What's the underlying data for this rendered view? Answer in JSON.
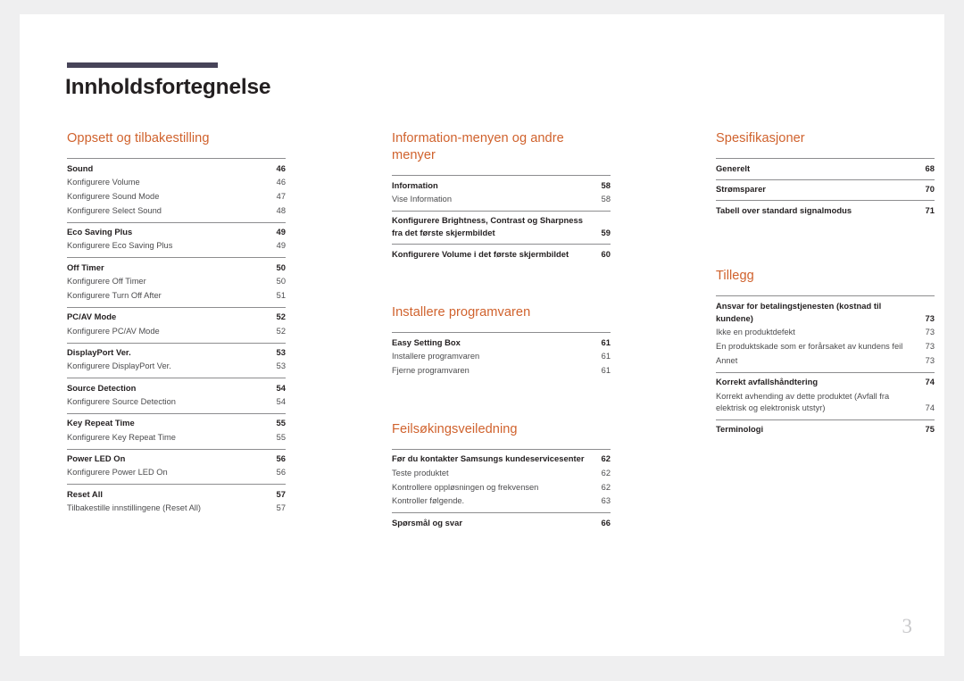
{
  "document": {
    "title": "Innholdsfortegnelse",
    "folio": "3",
    "accent_color": "#d0622d",
    "rule_color": "#474459",
    "text_color": "#231f20"
  },
  "columns": [
    {
      "id": "column-1",
      "sections": [
        {
          "heading": "Oppsett og tilbakestilling",
          "groups": [
            {
              "entries": [
                {
                  "level": 1,
                  "label": "Sound",
                  "page": "46"
                },
                {
                  "level": 2,
                  "label": "Konfigurere Volume",
                  "page": "46"
                },
                {
                  "level": 2,
                  "label": "Konfigurere Sound Mode",
                  "page": "47"
                },
                {
                  "level": 2,
                  "label": "Konfigurere Select Sound",
                  "page": "48"
                }
              ]
            },
            {
              "entries": [
                {
                  "level": 1,
                  "label": "Eco Saving Plus",
                  "page": "49"
                },
                {
                  "level": 2,
                  "label": "Konfigurere Eco Saving Plus",
                  "page": "49"
                }
              ]
            },
            {
              "entries": [
                {
                  "level": 1,
                  "label": "Off Timer",
                  "page": "50"
                },
                {
                  "level": 2,
                  "label": "Konfigurere Off Timer",
                  "page": "50"
                },
                {
                  "level": 2,
                  "label": "Konfigurere Turn Off After",
                  "page": "51"
                }
              ]
            },
            {
              "entries": [
                {
                  "level": 1,
                  "label": "PC/AV Mode",
                  "page": "52"
                },
                {
                  "level": 2,
                  "label": "Konfigurere PC/AV Mode",
                  "page": "52"
                }
              ]
            },
            {
              "entries": [
                {
                  "level": 1,
                  "label": "DisplayPort Ver.",
                  "page": "53"
                },
                {
                  "level": 2,
                  "label": "Konfigurere DisplayPort Ver.",
                  "page": "53"
                }
              ]
            },
            {
              "entries": [
                {
                  "level": 1,
                  "label": "Source Detection",
                  "page": "54"
                },
                {
                  "level": 2,
                  "label": "Konfigurere Source Detection",
                  "page": "54"
                }
              ]
            },
            {
              "entries": [
                {
                  "level": 1,
                  "label": "Key Repeat Time",
                  "page": "55"
                },
                {
                  "level": 2,
                  "label": "Konfigurere Key Repeat Time",
                  "page": "55"
                }
              ]
            },
            {
              "entries": [
                {
                  "level": 1,
                  "label": "Power LED On",
                  "page": "56"
                },
                {
                  "level": 2,
                  "label": "Konfigurere Power LED On",
                  "page": "56"
                }
              ]
            },
            {
              "entries": [
                {
                  "level": 1,
                  "label": "Reset All",
                  "page": "57"
                },
                {
                  "level": 2,
                  "label": "Tilbakestille innstillingene (Reset All)",
                  "page": "57"
                }
              ]
            }
          ]
        }
      ]
    },
    {
      "id": "column-2",
      "sections": [
        {
          "heading": "Information-menyen og andre menyer",
          "groups": [
            {
              "entries": [
                {
                  "level": 1,
                  "label": "Information",
                  "page": "58"
                },
                {
                  "level": 2,
                  "label": "Vise Information",
                  "page": "58"
                }
              ]
            },
            {
              "entries": [
                {
                  "level": 1,
                  "multiline": true,
                  "label": "Konfigurere Brightness, Contrast og Sharpness fra det første skjermbildet",
                  "page": "59"
                }
              ]
            },
            {
              "entries": [
                {
                  "level": 1,
                  "multiline": true,
                  "label": "Konfigurere Volume i det første skjermbildet",
                  "page": "60"
                }
              ]
            }
          ]
        },
        {
          "heading": "Installere programvaren",
          "groups": [
            {
              "entries": [
                {
                  "level": 1,
                  "label": "Easy Setting Box",
                  "page": "61"
                },
                {
                  "level": 2,
                  "label": "Installere programvaren",
                  "page": "61"
                },
                {
                  "level": 2,
                  "label": "Fjerne programvaren",
                  "page": "61"
                }
              ]
            }
          ]
        },
        {
          "heading": "Feilsøkingsveiledning",
          "groups": [
            {
              "entries": [
                {
                  "level": 1,
                  "multiline": true,
                  "label": "Før du kontakter Samsungs kundeservicesenter",
                  "page": "62"
                },
                {
                  "level": 2,
                  "label": "Teste produktet",
                  "page": "62"
                },
                {
                  "level": 2,
                  "label": "Kontrollere oppløsningen og frekvensen",
                  "page": "62"
                },
                {
                  "level": 2,
                  "label": "Kontroller følgende.",
                  "page": "63"
                }
              ]
            },
            {
              "entries": [
                {
                  "level": 1,
                  "label": "Spørsmål og svar",
                  "page": "66"
                }
              ]
            }
          ]
        }
      ]
    },
    {
      "id": "column-3",
      "sections": [
        {
          "heading": "Spesifikasjoner",
          "groups": [
            {
              "entries": [
                {
                  "level": 1,
                  "label": "Generelt",
                  "page": "68"
                }
              ]
            },
            {
              "entries": [
                {
                  "level": 1,
                  "label": "Strømsparer",
                  "page": "70"
                }
              ]
            },
            {
              "entries": [
                {
                  "level": 1,
                  "label": "Tabell over standard signalmodus",
                  "page": "71"
                }
              ]
            }
          ]
        },
        {
          "heading": "Tillegg",
          "groups": [
            {
              "entries": [
                {
                  "level": 1,
                  "multiline": true,
                  "label": "Ansvar for betalingstjenesten (kostnad til kundene)",
                  "page": "73"
                },
                {
                  "level": 2,
                  "label": "Ikke en produktdefekt",
                  "page": "73"
                },
                {
                  "level": 2,
                  "multiline": true,
                  "label": "En produktskade som er forårsaket av kundens feil",
                  "page": "73"
                },
                {
                  "level": 2,
                  "label": "Annet",
                  "page": "73"
                }
              ]
            },
            {
              "entries": [
                {
                  "level": 1,
                  "label": "Korrekt avfallshåndtering",
                  "page": "74"
                },
                {
                  "level": 2,
                  "multiline": true,
                  "label": "Korrekt avhending av dette produktet (Avfall fra elektrisk og elektronisk utstyr)",
                  "page": "74"
                }
              ]
            },
            {
              "entries": [
                {
                  "level": 1,
                  "label": "Terminologi",
                  "page": "75"
                }
              ]
            }
          ]
        }
      ]
    }
  ]
}
